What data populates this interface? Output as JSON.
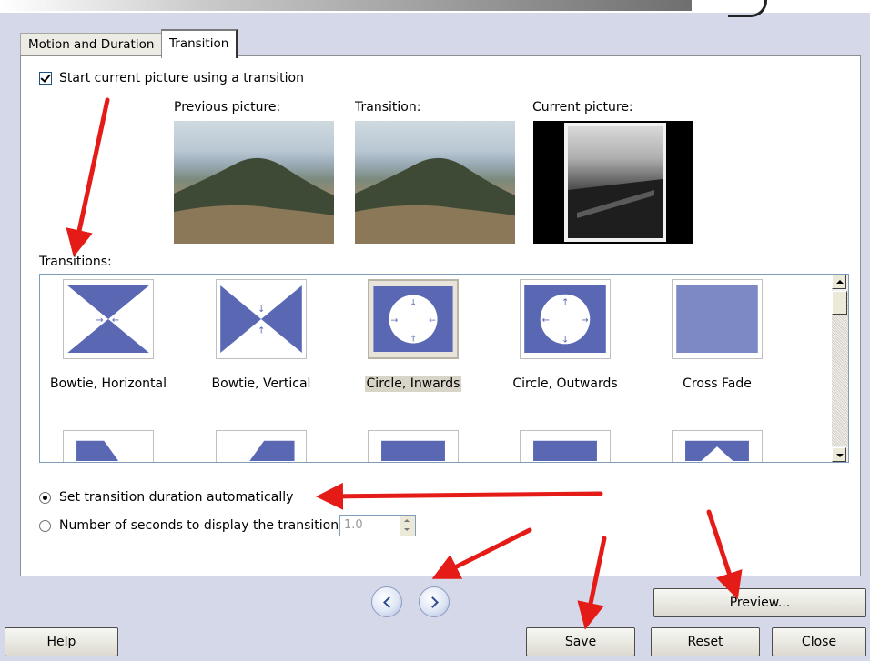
{
  "tabs": [
    {
      "label": "Motion and Duration",
      "active": false
    },
    {
      "label": "Transition",
      "active": true
    }
  ],
  "start_checkbox": {
    "label": "Start current picture using a transition",
    "checked": true
  },
  "previews": {
    "previous_label": "Previous picture:",
    "transition_label": "Transition:",
    "current_label": "Current picture:"
  },
  "transitions_label": "Transitions:",
  "transitions": [
    {
      "label": "Bowtie, Horizontal",
      "icon": "bowtie-horizontal-icon"
    },
    {
      "label": "Bowtie, Vertical",
      "icon": "bowtie-vertical-icon"
    },
    {
      "label": "Circle, Inwards",
      "icon": "circle-inwards-icon",
      "selected": true
    },
    {
      "label": "Circle, Outwards",
      "icon": "circle-outwards-icon"
    },
    {
      "label": "Cross Fade",
      "icon": "cross-fade-icon"
    }
  ],
  "duration": {
    "auto_label": "Set transition duration automatically",
    "auto_selected": true,
    "manual_label": "Number of seconds to display the transition",
    "seconds_value": "1.0"
  },
  "buttons": {
    "preview": "Preview...",
    "help": "Help",
    "save": "Save",
    "reset": "Reset",
    "close": "Close"
  },
  "colors": {
    "accent_blue": "#5a68b4",
    "annotation_red": "#e41b17",
    "dialog_bg": "#d4d8e8"
  }
}
